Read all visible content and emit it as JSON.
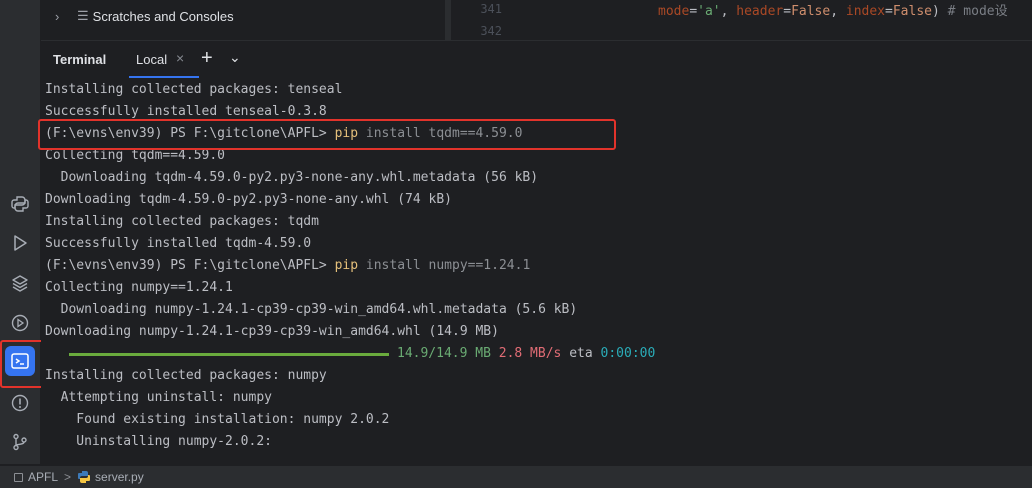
{
  "project_tree": {
    "item_label": "Scratches and Consoles",
    "chevron_icon": "chevron-right-icon",
    "item_icon": "scratches-icon"
  },
  "editor": {
    "line_numbers": [
      "341",
      "342"
    ],
    "code": {
      "p1": "mode",
      "v1": "'a'",
      "p2": "header",
      "v2": "False",
      "p3": "index",
      "v3": "False",
      "comment": "# mode设",
      "eq": "=",
      "comma": ", ",
      "close": ")  "
    }
  },
  "terminal_panel": {
    "title": "Terminal",
    "tab_label": "Local",
    "close_glyph": "×",
    "plus_glyph": "+",
    "dropdown_glyph": "⌄"
  },
  "terminal_output": {
    "line1": "Installing collected packages: tenseal",
    "line2": "Successfully installed tenseal-0.3.8",
    "prompt": "(F:\\evns\\env39) PS F:\\gitclone\\APFL> ",
    "cmd_pip": "pip",
    "cmd1_args": " install tqdm==4.59.0",
    "line4": "Collecting tqdm==4.59.0",
    "line5": "  Downloading tqdm-4.59.0-py2.py3-none-any.whl.metadata (56 kB)",
    "line6": "Downloading tqdm-4.59.0-py2.py3-none-any.whl (74 kB)",
    "line7": "Installing collected packages: tqdm",
    "line8": "Successfully installed tqdm-4.59.0",
    "cmd2_args": " install numpy==1.24.1",
    "line10": "Collecting numpy==1.24.1",
    "line11": "  Downloading numpy-1.24.1-cp39-cp39-win_amd64.whl.metadata (5.6 kB)",
    "line12": "Downloading numpy-1.24.1-cp39-cp39-win_amd64.whl (14.9 MB)",
    "progress": {
      "fraction": 1.0,
      "size_text": "14.9/14.9 MB",
      "speed_text": "2.8 MB/s",
      "eta_label": "eta",
      "eta_value": "0:00:00"
    },
    "line14": "Installing collected packages: numpy",
    "line15": "  Attempting uninstall: numpy",
    "line16": "    Found existing installation: numpy 2.0.2",
    "line17": "    Uninstalling numpy-2.0.2:"
  },
  "sidebar": {
    "icons": [
      "python-console-icon",
      "run-icon",
      "layers-icon",
      "services-icon",
      "terminal-icon",
      "problems-icon",
      "git-icon"
    ]
  },
  "status_bar": {
    "project": "APFL",
    "separator": ">",
    "file": "server.py"
  },
  "colors": {
    "accent": "#3574f0",
    "highlight_box": "#e2332b",
    "progress_green": "#6aab3d"
  }
}
